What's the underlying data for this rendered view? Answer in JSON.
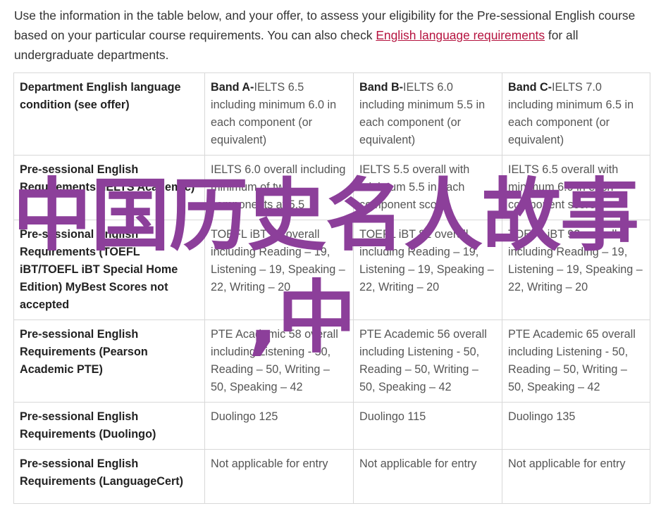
{
  "intro": {
    "before_link": "Use the information in the table below, and your offer, to assess your eligibility for the Pre-sessional English course based on your particular course requirements. You can also check ",
    "link_text": "English language requirements",
    "after_link": " for all undergraduate departments."
  },
  "table": {
    "rows": [
      {
        "head": "Department English language condition (see offer)",
        "cells": [
          {
            "bold": "Band A-",
            "text": "IELTS 6.5 including minimum 6.0 in each component (or equivalent)"
          },
          {
            "bold": "Band B-",
            "text": "IELTS 6.0 including minimum 5.5 in each component (or equivalent)"
          },
          {
            "bold": "Band C-",
            "text": "IELTS 7.0 including minimum 6.5 in each component (or equivalent)"
          }
        ]
      },
      {
        "head": "Pre-sessional English Requirements (IELTS Academic)",
        "cells": [
          {
            "bold": "",
            "text": "IELTS 6.0 overall including minimum of two components at 5.5"
          },
          {
            "bold": "",
            "text": "IELTS 5.5 overall with minimum 5.5 in each component score"
          },
          {
            "bold": "",
            "text": "IELTS 6.5 overall with minimum 6.0 in each component score"
          }
        ]
      },
      {
        "head": "Pre-sessional English Requirements (TOEFL iBT/TOEFL iBT Special Home Edition) MyBest Scores not accepted",
        "cells": [
          {
            "bold": "",
            "text": "TOEFL iBT 87 overall including Reading – 19, Listening – 19, Speaking – 22, Writing – 20"
          },
          {
            "bold": "",
            "text": "TOEFL iBT 82 overall including Reading – 19, Listening – 19, Speaking – 22, Writing – 20"
          },
          {
            "bold": "",
            "text": "TOEFL iBT 92 overall including Reading – 19, Listening – 19, Speaking – 22, Writing – 20"
          }
        ]
      },
      {
        "head": "Pre-sessional English Requirements (Pearson Academic PTE)",
        "cells": [
          {
            "bold": "",
            "text": "PTE Academic 58 overall including Listening - 50, Reading – 50, Writing – 50, Speaking – 42"
          },
          {
            "bold": "",
            "text": "PTE Academic 56 overall including Listening - 50, Reading – 50, Writing – 50, Speaking – 42"
          },
          {
            "bold": "",
            "text": "PTE Academic 65 overall including Listening - 50, Reading – 50, Writing – 50, Speaking – 42"
          }
        ]
      },
      {
        "head": "Pre-sessional English Requirements (Duolingo)",
        "cells": [
          {
            "bold": "",
            "text": "Duolingo 125"
          },
          {
            "bold": "",
            "text": "Duolingo 115"
          },
          {
            "bold": "",
            "text": "Duolingo 135"
          }
        ]
      },
      {
        "head": "Pre-sessional English Requirements (LanguageCert)",
        "cells": [
          {
            "bold": "",
            "text": "Not applicable for entry"
          },
          {
            "bold": "",
            "text": "Not applicable for entry"
          },
          {
            "bold": "",
            "text": "Not applicable for entry"
          }
        ]
      }
    ]
  },
  "watermark": {
    "line1": "中国历史名人故事",
    "line2": ",中",
    "color": "#8c3f9a"
  },
  "colors": {
    "link": "#b5123e",
    "border": "#d8d8d8"
  }
}
